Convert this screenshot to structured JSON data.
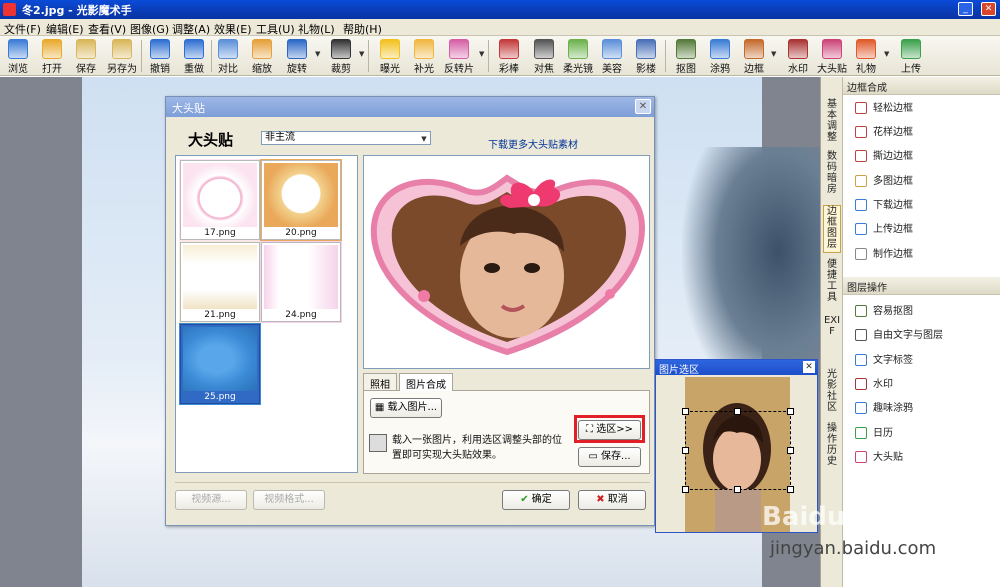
{
  "window": {
    "title": "冬2.jpg - 光影魔术手",
    "min_icon": "minimize-icon",
    "max_icon": "maximize-icon",
    "close_icon": "close-icon"
  },
  "menu": [
    {
      "label": "文件(F)"
    },
    {
      "label": "编辑(E)"
    },
    {
      "label": "查看(V)"
    },
    {
      "label": "图像(G)"
    },
    {
      "label": "调整(A)"
    },
    {
      "label": "效果(E)"
    },
    {
      "label": "工具(U)"
    },
    {
      "label": "礼物(L)"
    },
    {
      "label": "帮助(H)"
    }
  ],
  "toolbar": [
    {
      "label": "浏览",
      "icon": "browse-icon",
      "color": "#3a7bd5"
    },
    {
      "label": "打开",
      "icon": "folder-open-icon",
      "color": "#e8a92c"
    },
    {
      "label": "保存",
      "icon": "save-icon",
      "color": "#d9b65a"
    },
    {
      "label": "另存为",
      "icon": "save-as-icon",
      "color": "#d9b65a"
    },
    {
      "label": "撤销",
      "icon": "undo-icon",
      "color": "#2d6fd1"
    },
    {
      "label": "重做",
      "icon": "redo-icon",
      "color": "#2d6fd1"
    },
    {
      "label": "对比",
      "icon": "compare-icon",
      "color": "#5a8fd8"
    },
    {
      "label": "缩放",
      "icon": "zoom-icon",
      "color": "#e5a03a"
    },
    {
      "label": "旋转",
      "icon": "rotate-icon",
      "color": "#2a67c7"
    },
    {
      "label": "裁剪",
      "icon": "crop-icon",
      "color": "#333333"
    },
    {
      "label": "曝光",
      "icon": "exposure-icon",
      "color": "#f2c11d"
    },
    {
      "label": "补光",
      "icon": "fill-light-icon",
      "color": "#f0b640"
    },
    {
      "label": "反转片",
      "icon": "reversal-film-icon",
      "color": "#d65fa6"
    },
    {
      "label": "彩棒",
      "icon": "color-wand-icon",
      "color": "#c43a3a"
    },
    {
      "label": "对焦",
      "icon": "focus-icon",
      "color": "#555555"
    },
    {
      "label": "柔光镜",
      "icon": "soft-light-icon",
      "color": "#6bb24c"
    },
    {
      "label": "美容",
      "icon": "beauty-icon",
      "color": "#5a8fd8"
    },
    {
      "label": "影楼",
      "icon": "studio-icon",
      "color": "#4a6fb8"
    },
    {
      "label": "抠图",
      "icon": "cutout-icon",
      "color": "#557a3a"
    },
    {
      "label": "涂鸦",
      "icon": "doodle-icon",
      "color": "#3a7bd5"
    },
    {
      "label": "边框",
      "icon": "frame-icon",
      "color": "#c46a2a"
    },
    {
      "label": "水印",
      "icon": "watermark-icon",
      "color": "#aa3333"
    },
    {
      "label": "大头贴",
      "icon": "sticker-photo-icon",
      "color": "#cc4477"
    },
    {
      "label": "礼物",
      "icon": "gift-icon",
      "color": "#e05a2a"
    },
    {
      "label": "上传",
      "icon": "upload-icon",
      "color": "#3aa04a"
    }
  ],
  "side_tabs": [
    {
      "label": "基本调整"
    },
    {
      "label": "数码暗房"
    },
    {
      "label": "边框图层",
      "active": true
    },
    {
      "label": "便捷工具"
    },
    {
      "label": "EXIF"
    },
    {
      "label": "光影社区"
    },
    {
      "label": "操作历史"
    }
  ],
  "panel": {
    "collapse": "|||>",
    "frame_section": "边框合成",
    "frame_items": [
      {
        "label": "轻松边框",
        "icon": "easy-frame-icon"
      },
      {
        "label": "花样边框",
        "icon": "pattern-frame-icon"
      },
      {
        "label": "撕边边框",
        "icon": "torn-frame-icon"
      },
      {
        "label": "多图边框",
        "icon": "multi-frame-icon"
      },
      {
        "label": "下载边框",
        "icon": "download-frame-icon"
      },
      {
        "label": "上传边框",
        "icon": "upload-frame-icon"
      },
      {
        "label": "制作边框",
        "icon": "make-frame-icon"
      }
    ],
    "layer_section": "图层操作",
    "layer_items": [
      {
        "label": "容易抠图",
        "icon": "cutout-icon"
      },
      {
        "label": "自由文字与图层",
        "icon": "text-layer-icon"
      },
      {
        "label": "文字标签",
        "icon": "text-label-icon"
      },
      {
        "label": "水印",
        "icon": "watermark-icon"
      },
      {
        "label": "趣味涂鸦",
        "icon": "doodle-icon"
      },
      {
        "label": "日历",
        "icon": "calendar-icon"
      },
      {
        "label": "大头贴",
        "icon": "sticker-photo-icon"
      }
    ]
  },
  "dialog": {
    "title": "大头贴",
    "heading": "大头贴",
    "category": "非主流",
    "download_link": "下载更多大头贴素材",
    "thumbnails": [
      {
        "label": "17.png",
        "selected": false,
        "color": "#fbe3ef"
      },
      {
        "label": "20.png",
        "selected": false,
        "color": "#e9a85a"
      },
      {
        "label": "21.png",
        "selected": false,
        "color": "#f7eed6"
      },
      {
        "label": "24.png",
        "selected": false,
        "color": "#f6d3ea"
      },
      {
        "label": "25.png",
        "selected": true,
        "color": "#3b8ad6"
      }
    ],
    "tabs": [
      {
        "label": "照相",
        "active": false
      },
      {
        "label": "图片合成",
        "active": true
      }
    ],
    "load_button": "载入图片...",
    "hint": "载入一张图片，利用选区调整头部的位置即可实现大头贴效果。",
    "select_button": "选区>>",
    "save_button": "保存...",
    "video_source_button": "视频源...",
    "video_format_button": "视频格式...",
    "ok_button": "确定",
    "cancel_button": "取消"
  },
  "selection_window": {
    "title": "图片选区"
  },
  "watermark": {
    "brand": "Baidu经验",
    "url": "jingyan.baidu.com"
  }
}
